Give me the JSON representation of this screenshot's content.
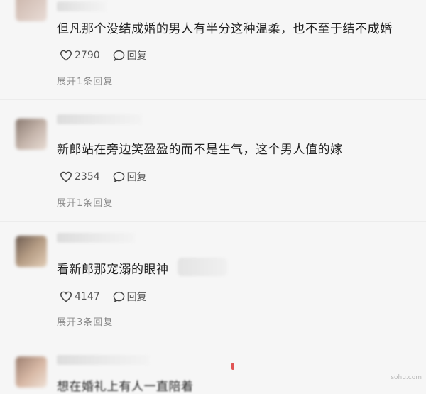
{
  "comments": [
    {
      "text": "但凡那个没结成婚的男人有半分这种温柔，也不至于结不成婚",
      "likes": "2790",
      "reply_label": "回复",
      "expand": "展开1条回复"
    },
    {
      "text": "新郎站在旁边笑盈盈的而不是生气，这个男人值的嫁",
      "likes": "2354",
      "reply_label": "回复",
      "expand": "展开1条回复"
    },
    {
      "text": "看新郎那宠溺的眼神",
      "likes": "4147",
      "reply_label": "回复",
      "expand": "展开3条回复"
    },
    {
      "text": "想在婚礼上有人一直陪着"
    }
  ],
  "colors": {
    "background": "#f6f6f6",
    "text": "#222222",
    "muted": "#8a8a8a",
    "accent": "#e05454"
  },
  "watermark": "sohu.com"
}
